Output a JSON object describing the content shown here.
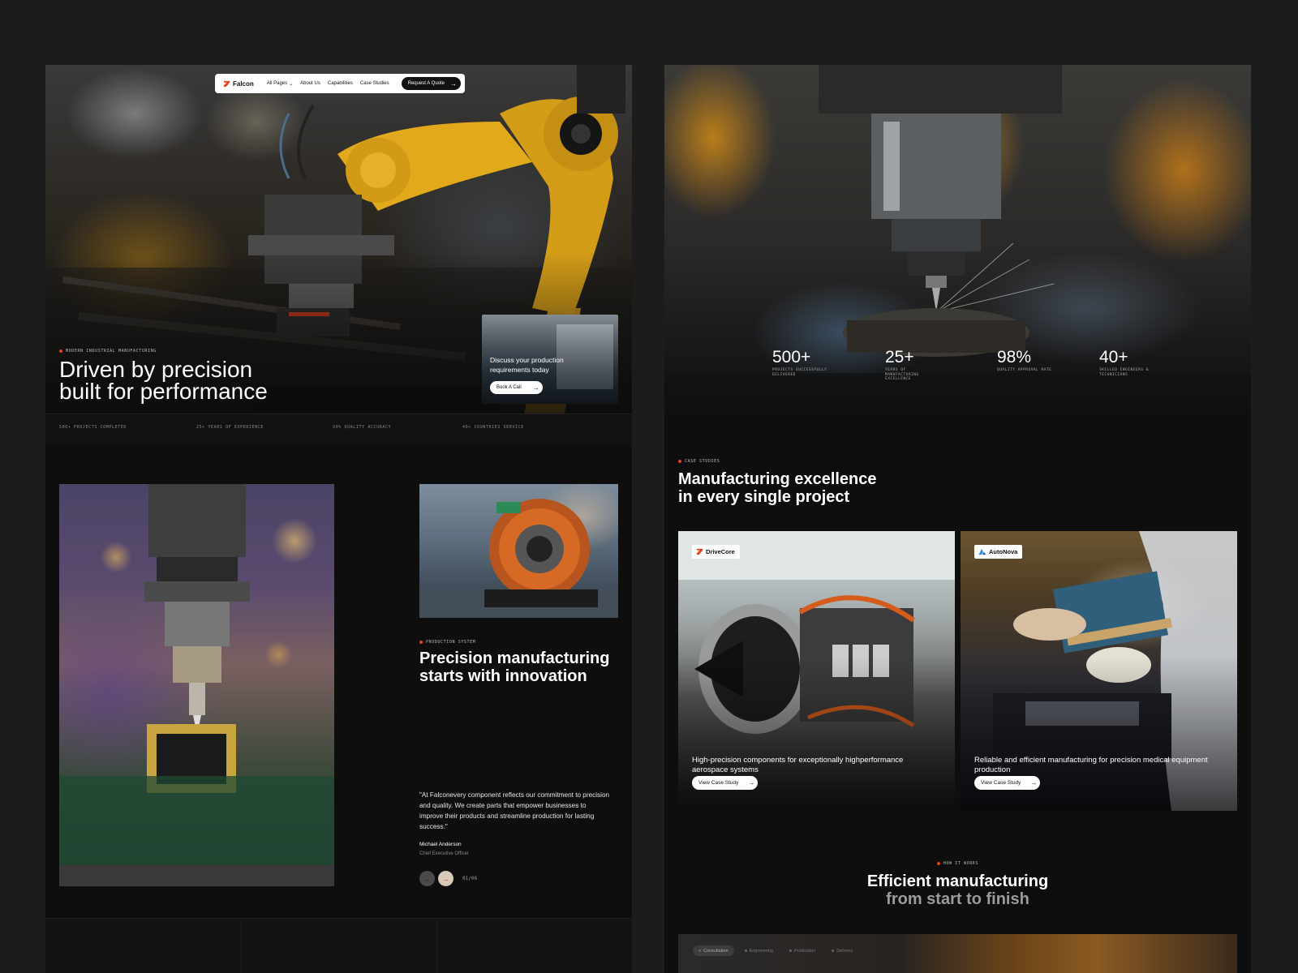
{
  "colors": {
    "accent": "#e8431d",
    "background": "#1c1c1c",
    "panel": "#0e0e0e"
  },
  "left": {
    "nav": {
      "brand": "Falcon",
      "items": [
        {
          "label": "All Pages",
          "has_dropdown": true
        },
        {
          "label": "About Us"
        },
        {
          "label": "Capabilities"
        },
        {
          "label": "Case Studies"
        }
      ],
      "cta": "Request A Quote"
    },
    "hero": {
      "eyebrow": "Modern Industrial Manufacturing",
      "title_line1": "Driven by precision",
      "title_line2": "built for performance",
      "card_text": "Discuss your production requirements today",
      "card_button": "Book A Call"
    },
    "strip": [
      "500+ Projects Completed",
      "25+ Years of Experience",
      "99% Quality Accuracy",
      "40+ Countries Service"
    ],
    "production": {
      "eyebrow": "Production System",
      "title_line1": "Precision manufacturing",
      "title_line2": "starts with innovation",
      "quote": "\"At Falconevery component reflects our commitment to precision and quality. We create parts that empower businesses to improve their products and streamline production for lasting success.\"",
      "author": "Michael Anderson",
      "role": "Chief Executive Officer",
      "counter": "01/06"
    }
  },
  "right": {
    "stats": [
      {
        "value": "500+",
        "label": "Projects Successfully Delivered"
      },
      {
        "value": "25+",
        "label": "Years of Manufacturing Excellence"
      },
      {
        "value": "98%",
        "label": "Quality Approval Rate"
      },
      {
        "value": "40+",
        "label": "Skilled Engineers & Technicians"
      }
    ],
    "case_studies": {
      "eyebrow": "Case Studies",
      "title_line1": "Manufacturing excellence",
      "title_line2": "in every single project",
      "cards": [
        {
          "brand": "DriveCore",
          "description": "High-precision components for exceptionally highperformance aerospace systems",
          "button": "View Case Study"
        },
        {
          "brand": "AutoNova",
          "description": "Reliable and efficient manufacturing for precision medical equipment production",
          "button": "View Case Study"
        }
      ]
    },
    "how_it_works": {
      "eyebrow": "How It Works",
      "title_line1": "Efficient manufacturing",
      "title_line2": "from start to finish",
      "steps": [
        "Consultation",
        "Engineering",
        "Production",
        "Delivery"
      ]
    }
  }
}
